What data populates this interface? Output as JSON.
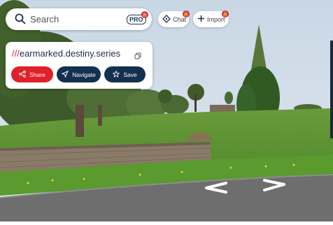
{
  "search": {
    "placeholder": "Search",
    "pro_badge": "PRO"
  },
  "toolbar": {
    "chat_label": "Chat",
    "import_label": "Import"
  },
  "location_card": {
    "prefix": "///",
    "address": "earmarked.destiny.series",
    "share_label": "Share",
    "navigate_label": "Navigate",
    "save_label": "Save"
  },
  "colors": {
    "accent_red": "#e0202a",
    "navy": "#13304f",
    "lock_red": "#e11d48"
  }
}
